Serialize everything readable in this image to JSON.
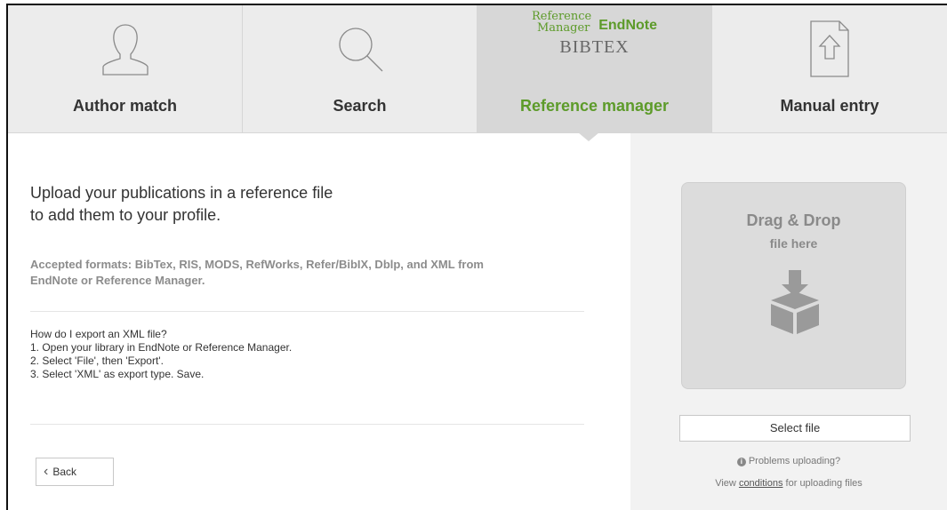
{
  "tabs": [
    {
      "id": "author-match",
      "label": "Author match",
      "icon": "person-silhouette-icon",
      "active": false
    },
    {
      "id": "search",
      "label": "Search",
      "icon": "magnifier-icon",
      "active": false
    },
    {
      "id": "reference-manager",
      "label": "Reference manager",
      "icon": "reference-logos",
      "active": true,
      "logos": {
        "refman_line1": "Reference",
        "refman_line2": "Manager",
        "endnote": "EndNote",
        "bibtex": "BIBTEX"
      }
    },
    {
      "id": "manual-entry",
      "label": "Manual entry",
      "icon": "document-upload-icon",
      "active": false
    }
  ],
  "main": {
    "intro_line1": "Upload your publications in a reference file",
    "intro_line2": "to add them to your profile.",
    "formats_line1": "Accepted formats: BibTex, RIS, MODS, RefWorks, Refer/BibIX, Dblp, and XML from",
    "formats_line2": "EndNote or Reference Manager.",
    "howto": {
      "question": "How do I export an XML file?",
      "steps": [
        "1. Open your library in EndNote or Reference Manager.",
        "2. Select 'File', then 'Export'.",
        "3. Select 'XML' as export type. Save."
      ]
    },
    "back_label": "Back"
  },
  "upload": {
    "drop_title": "Drag & Drop",
    "drop_sub": "file here",
    "select_label": "Select file",
    "problems_label": "Problems uploading?",
    "conditions_prefix": "View",
    "conditions_link": "conditions",
    "conditions_suffix": "for uploading files"
  },
  "colors": {
    "accent_green": "#5d9b2a",
    "tab_bg": "#ececec",
    "tab_active_bg": "#d7d7d7",
    "dropzone_bg": "#dcdcdc",
    "right_panel_bg": "#f2f2f2"
  }
}
